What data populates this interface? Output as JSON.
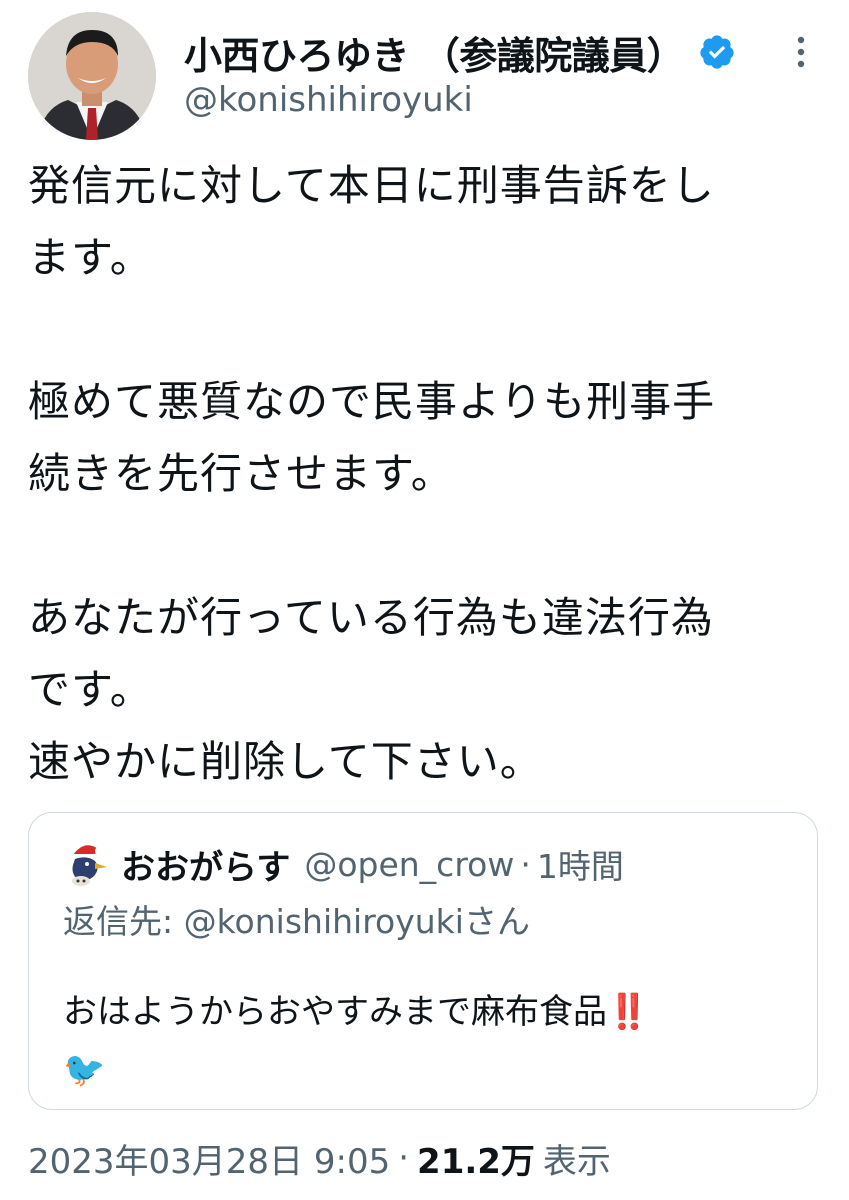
{
  "user": {
    "display_name": "小西ひろゆき （参議院議員）",
    "handle": "@konishihiroyuki",
    "verified": true,
    "avatar_icon": "profile-photo",
    "verified_color": "#1d9bf0"
  },
  "tweet": {
    "text": "発信元に対して本日に刑事告訴をし\nます。\n\n極めて悪質なので民事よりも刑事手\n続きを先行させます。\n\nあなたが行っている行為も違法行為\nです。\n速やかに削除して下さい。"
  },
  "quoted_tweet": {
    "name": "おおがらす",
    "handle": "@open_crow",
    "separator": "·",
    "time": "1時間",
    "reply_prefix": "返信先:",
    "reply_handle": "@konishihiroyuki",
    "reply_suffix": "さん",
    "text": "おはようからおやすみまで麻布食品‼️\n🐦",
    "avatar_icon": "crow-santa-hat-icon"
  },
  "footer": {
    "timestamp": "2023年03月28日 9:05",
    "separator": "·",
    "views": "21.2万",
    "views_label": "表示"
  }
}
